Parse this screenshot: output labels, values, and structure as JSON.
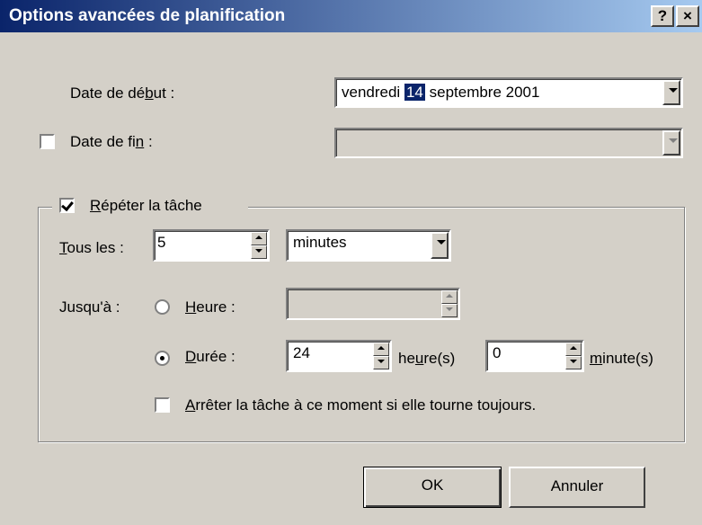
{
  "window": {
    "title": "Options avancées de planification",
    "help_label": "?",
    "close_label": "×"
  },
  "start_date": {
    "label_pre": "Date de dé",
    "label_key": "b",
    "label_post": "ut :",
    "weekday": "vendredi",
    "day": "14",
    "month_year": "septembre 2001"
  },
  "end_date": {
    "label_pre": "Date de fi",
    "label_key": "n",
    "label_post": " :",
    "checked": false,
    "value": ""
  },
  "repeat": {
    "checked": true,
    "label_key": "R",
    "label_rest": "épéter la tâche",
    "every_key": "T",
    "every_rest": "ous les :",
    "every_value": "5",
    "unit_value": "minutes",
    "until_label": "Jusqu'à :",
    "time_key": "H",
    "time_rest": "eure :",
    "time_selected": false,
    "time_value": "",
    "duration_key": "D",
    "duration_rest": "urée :",
    "duration_selected": true,
    "hours_value": "24",
    "hours_pre": "he",
    "hours_key": "u",
    "hours_post": "re(s)",
    "minutes_value": "0",
    "minutes_key": "m",
    "minutes_rest": "inute(s)",
    "stop_checked": false,
    "stop_key": "A",
    "stop_rest": "rrêter la tâche à ce moment si elle tourne toujours."
  },
  "buttons": {
    "ok": "OK",
    "cancel": "Annuler"
  }
}
